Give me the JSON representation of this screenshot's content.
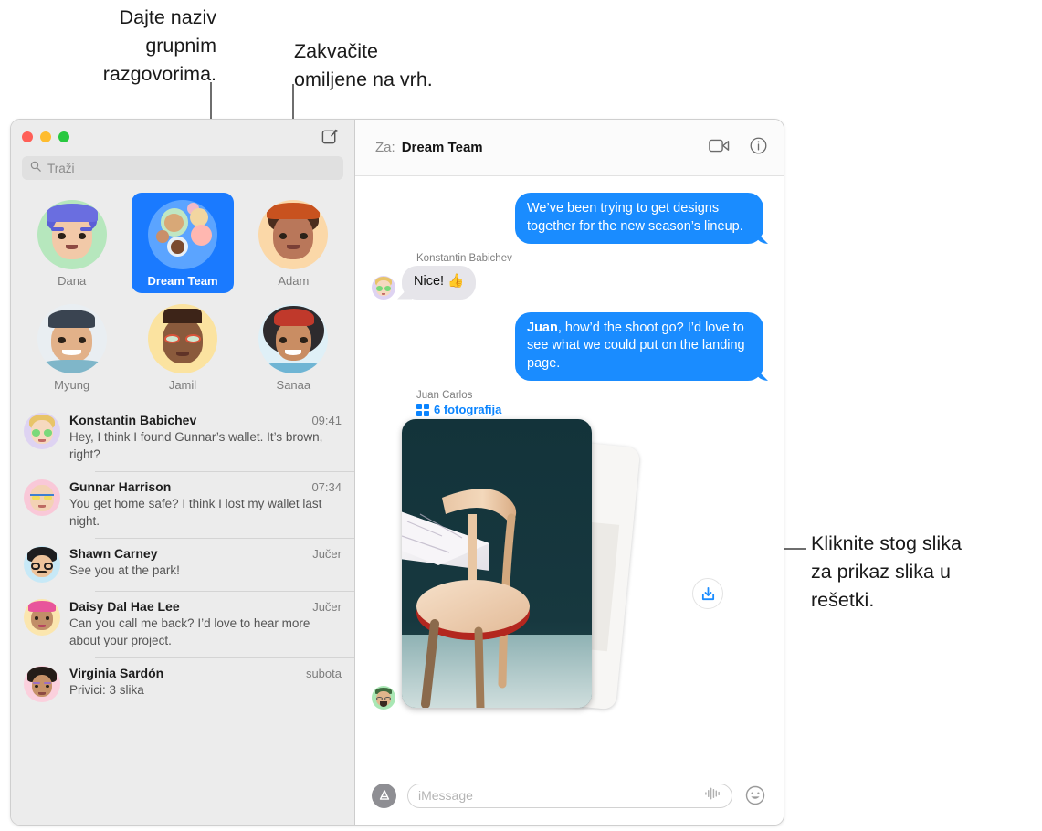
{
  "callouts": [
    {
      "id": "c1",
      "text": "Dajte naziv\ngrupnim\nrazgovorima."
    },
    {
      "id": "c2",
      "text": "Zakvačite\nomiljene na vrh."
    },
    {
      "id": "c3",
      "text": "Kliknite stog slika\nza prikaz slika u\nrešetki."
    }
  ],
  "window": {
    "traffic_lights": [
      "close",
      "minimize",
      "zoom"
    ],
    "compose_icon": "compose-icon"
  },
  "sidebar": {
    "search": {
      "placeholder": "Traži",
      "icon": "search-icon",
      "value": ""
    },
    "pinned": [
      {
        "label": "Dana",
        "selected": false
      },
      {
        "label": "Dream Team",
        "selected": true
      },
      {
        "label": "Adam",
        "selected": false
      },
      {
        "label": "Myung",
        "selected": false
      },
      {
        "label": "Jamil",
        "selected": false
      },
      {
        "label": "Sanaa",
        "selected": false
      }
    ],
    "conversations": [
      {
        "name": "Konstantin Babichev",
        "time": "09:41",
        "preview": "Hey, I think I found Gunnar’s wallet. It’s brown, right?"
      },
      {
        "name": "Gunnar Harrison",
        "time": "07:34",
        "preview": "You get home safe? I think I lost my wallet last night."
      },
      {
        "name": "Shawn Carney",
        "time": "Jučer",
        "preview": "See you at the park!"
      },
      {
        "name": "Daisy Dal Hae Lee",
        "time": "Jučer",
        "preview": "Can you call me back? I’d love to hear more about your project."
      },
      {
        "name": "Virginia Sardón",
        "time": "subota",
        "preview": "Privici:  3 slika"
      }
    ]
  },
  "main": {
    "header": {
      "to_label": "Za:",
      "to_value": "Dream Team",
      "facetime_icon": "video-camera-icon",
      "info_icon": "info-circle-icon"
    },
    "messages": [
      {
        "dir": "out",
        "text": "We’ve been trying to get designs together for the new season’s lineup."
      },
      {
        "dir": "in",
        "sender": "Konstantin Babichev",
        "text": "Nice!  👍"
      },
      {
        "dir": "out",
        "bold_prefix": "Juan",
        "text": ", how’d the shoot go? I’d love to see what we could put on the landing page."
      }
    ],
    "attachment": {
      "sender": "Juan Carlos",
      "photos_label": "6 fotografija",
      "grid_icon": "grid-icon",
      "download_icon": "download-icon",
      "count": 6
    },
    "composer": {
      "apps_icon": "app-store-icon",
      "placeholder": "iMessage",
      "value": "",
      "audio_icon": "audio-waveform-icon",
      "emoji_icon": "smiley-icon"
    }
  },
  "colors": {
    "accent_blue": "#1a8cff",
    "link_blue": "#0a84ff",
    "bubble_gray": "#e6e5ea",
    "sidebar_bg": "#ececec"
  }
}
